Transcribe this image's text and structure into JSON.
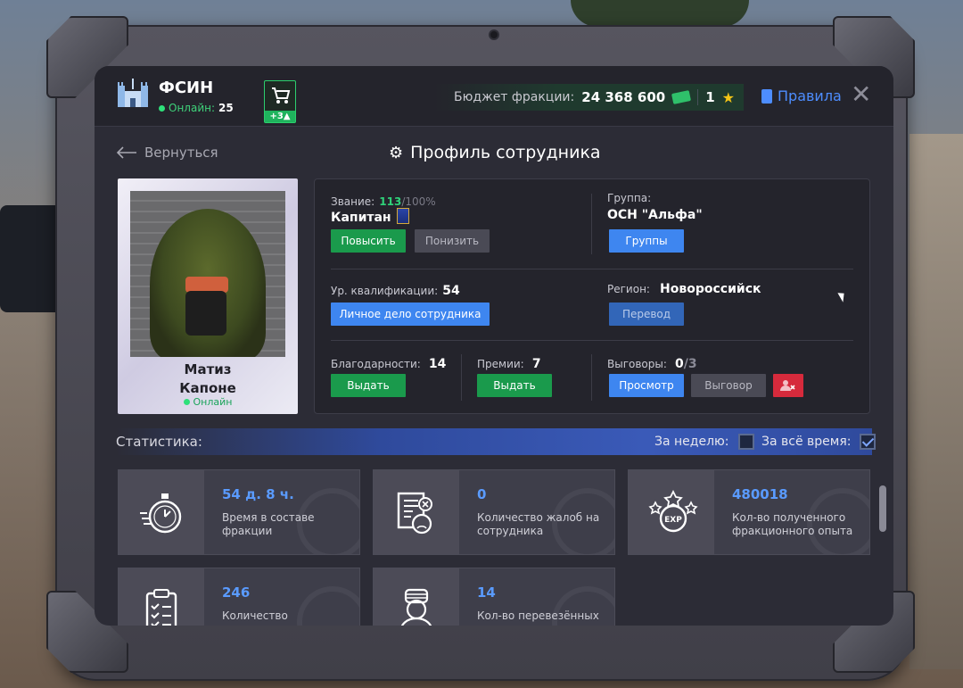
{
  "topbar": {
    "faction": "ФСИН",
    "online_label": "Онлайн:",
    "online_count": "25",
    "cart_badge": "+3",
    "budget_label": "Бюджет фракции:",
    "budget_value": "24 368 600",
    "stars": "1",
    "rules_label": "Правила"
  },
  "header": {
    "back_label": "Вернуться",
    "title": "Профиль сотрудника"
  },
  "person": {
    "first_name": "Матиз",
    "last_name": "Капоне",
    "status": "Онлайн"
  },
  "profile": {
    "rank_label": "Звание:",
    "rank_progress": "113",
    "rank_progress_max": "/100%",
    "rank_name": "Капитан",
    "promote_label": "Повысить",
    "demote_label": "Понизить",
    "group_label": "Группа:",
    "group_value": "ОСН \"Альфа\"",
    "groups_button": "Группы",
    "qual_label": "Ур. квалификации:",
    "qual_value": "54",
    "personal_file_button": "Личное дело сотрудника",
    "region_label": "Регион:",
    "region_value": "Новороссийск",
    "transfer_button": "Перевод",
    "thanks_label": "Благодарности:",
    "thanks_value": "14",
    "thanks_button": "Выдать",
    "bonus_label": "Премии:",
    "bonus_value": "7",
    "bonus_button": "Выдать",
    "reprimand_label": "Выговоры:",
    "reprimand_value": "0",
    "reprimand_max": "/3",
    "view_button": "Просмотр",
    "reprimand_button": "Выговор"
  },
  "stats": {
    "title": "Статистика:",
    "week_label": "За неделю:",
    "week_checked": false,
    "alltime_label": "За всё время:",
    "alltime_checked": true,
    "cards": [
      {
        "value": "54 д. 8 ч.",
        "desc": "Время в составе фракции",
        "icon": "stopwatch-icon"
      },
      {
        "value": "0",
        "desc": "Количество жалоб на сотрудника",
        "icon": "complaint-icon"
      },
      {
        "value": "480018",
        "desc": "Кол-во полученного фракционного опыта",
        "icon": "exp-icon"
      },
      {
        "value": "246",
        "desc": "Количество",
        "icon": "clipboard-icon"
      },
      {
        "value": "14",
        "desc": "Кол-во перевезённых",
        "icon": "prisoner-icon"
      }
    ]
  },
  "colors": {
    "accent_blue": "#3e86f0",
    "accent_green": "#1a9a4c",
    "danger_red": "#d62a3c",
    "stat_value": "#5a9bff"
  }
}
